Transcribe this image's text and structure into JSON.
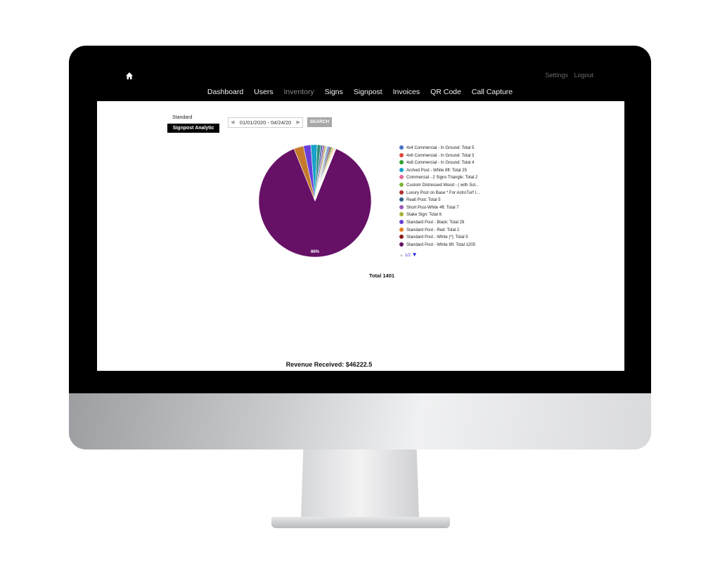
{
  "header": {
    "top_links": [
      "Settings",
      "Logout"
    ],
    "nav": [
      "Dashboard",
      "Users",
      "Inventory",
      "Signs",
      "Signpost",
      "Invoices",
      "QR Code",
      "Call Capture"
    ],
    "active_nav": "Inventory"
  },
  "tabs": {
    "standard": "Standard",
    "signpost_analytic": "Signpost Analytic"
  },
  "date_range": "01/01/2020 - 04/24/20",
  "search_label": "SEARCH",
  "legend_pager": "1/2",
  "total_label": "Total 1401",
  "revenue": "Revenue Received: $46222.5",
  "chart_data": {
    "type": "pie",
    "slice_label": "86%",
    "series": [
      {
        "name": "4x4 Commercial - In Ground: Total 5",
        "value": 5,
        "color": "#4472c4"
      },
      {
        "name": "4x6 Commercial - In Ground: Total 3",
        "value": 3,
        "color": "#e0483a"
      },
      {
        "name": "4x8 Commercial - In Ground: Total 4",
        "value": 4,
        "color": "#2ca02c"
      },
      {
        "name": "Arched Post - White 8ft: Total 25",
        "value": 25,
        "color": "#17a2c8"
      },
      {
        "name": "Commercial - 2 Signs Triangle: Total 2",
        "value": 2,
        "color": "#e5689a"
      },
      {
        "name": "Custom Distressed Wood - ( with Sol...",
        "value": 2,
        "color": "#7db53b"
      },
      {
        "name": "Luxury Post on Base * For AstroTurf I...",
        "value": 2,
        "color": "#b03030"
      },
      {
        "name": "Realt Post: Total 5",
        "value": 5,
        "color": "#2f5d8a"
      },
      {
        "name": "Short Post-White 4ft: Total 7",
        "value": 7,
        "color": "#9b59b6"
      },
      {
        "name": "Stake Sign: Total 6",
        "value": 6,
        "color": "#a8b03a"
      },
      {
        "name": "Standard Post - Black: Total 29",
        "value": 29,
        "color": "#6a3fd8"
      },
      {
        "name": "Standard Post - Red: Total 2",
        "value": 2,
        "color": "#e67e22"
      },
      {
        "name": "Standard Post - White (*): Total 5",
        "value": 5,
        "color": "#8b1a1a"
      },
      {
        "name": "Standard Post - White 8ft: Total 1205",
        "value": 1205,
        "color": "#661166"
      },
      {
        "name": "",
        "value": 14,
        "color": "#2f8f7a"
      },
      {
        "name": "",
        "value": 8,
        "color": "#4a6fa5"
      },
      {
        "name": "",
        "value": 38,
        "color": "#c47a2a"
      },
      {
        "name": "",
        "value": 6,
        "color": "#d9d9d9"
      },
      {
        "name": "",
        "value": 4,
        "color": "#f1c40f"
      }
    ]
  }
}
